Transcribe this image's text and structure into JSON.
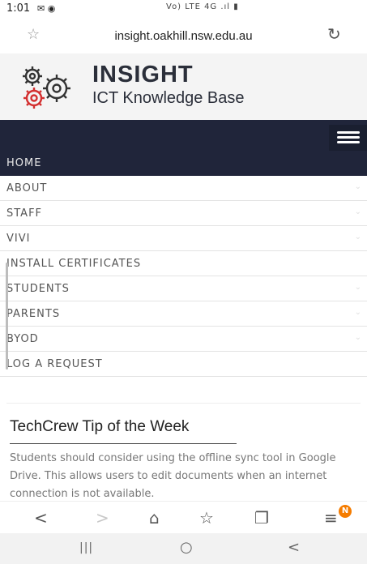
{
  "status_bar": {
    "time": "1:01",
    "left_icons": "✉ ◉",
    "right_text": "Vo) LTE 4G .ıl ▮"
  },
  "browser": {
    "url": "insight.oakhill.nsw.edu.au",
    "bookmark_glyph": "☆",
    "reload_glyph": "↻"
  },
  "header": {
    "title": "INSIGHT",
    "subtitle": "ICT Knowledge Base",
    "colors": {
      "gear_dark": "#333333",
      "gear_red": "#d32f2f",
      "nav_bg": "#20253a"
    }
  },
  "menu": {
    "items": [
      {
        "label": "HOME",
        "active": true,
        "chevron": ""
      },
      {
        "label": "ABOUT",
        "active": false,
        "chevron": "⌄"
      },
      {
        "label": "STAFF",
        "active": false,
        "chevron": "⌄"
      },
      {
        "label": "VIVI",
        "active": false,
        "chevron": "⌄"
      },
      {
        "label": "INSTALL CERTIFICATES",
        "active": false,
        "chevron": ""
      },
      {
        "label": "STUDENTS",
        "active": false,
        "chevron": "⌄"
      },
      {
        "label": "PARENTS",
        "active": false,
        "chevron": "⌄"
      },
      {
        "label": "BYOD",
        "active": false,
        "chevron": "⌄"
      },
      {
        "label": "LOG A REQUEST",
        "active": false,
        "chevron": ""
      }
    ]
  },
  "tip": {
    "title": "TechCrew Tip of the Week",
    "body": "Students should consider using the offline sync tool in Google Drive. This allows users to edit documents when an internet connection is not available."
  },
  "toolbar": {
    "back_glyph": "<",
    "forward_glyph": ">",
    "home_glyph": "⌂",
    "bookmarks_glyph": "☆",
    "tabs_glyph": "❐",
    "menu_glyph": "≡",
    "notification_badge": "N"
  },
  "system_nav": {
    "recents_glyph": "|||",
    "home_glyph": "○",
    "back_glyph": "<"
  }
}
